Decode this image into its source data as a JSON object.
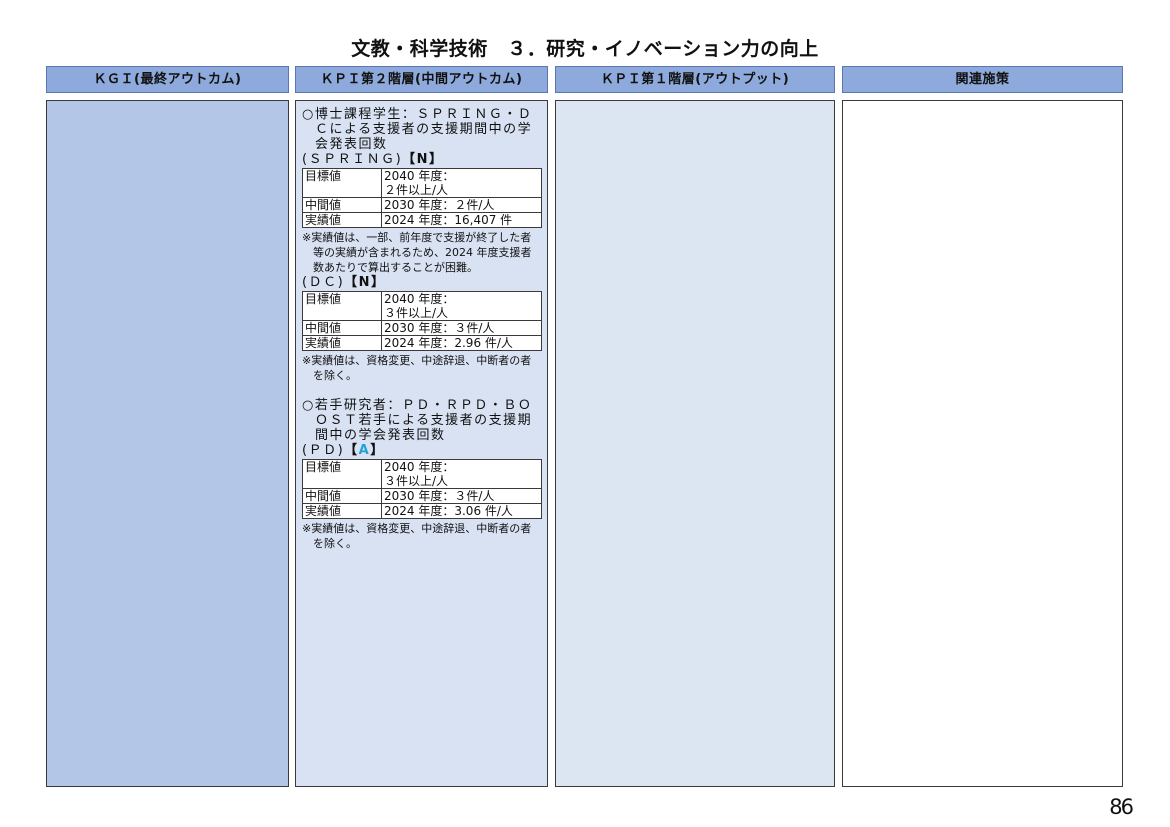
{
  "title": "文教・科学技術　３．研究・イノベーション力の向上",
  "columns": {
    "kgi": "ＫＧＩ(最終アウトカム)",
    "kpi2": "ＫＰＩ第２階層(中間アウトカム)",
    "kpi1": "ＫＰＩ第１階層(アウトプット)",
    "policy": "関連施策"
  },
  "kpi2": {
    "block1": {
      "heading": "○博士課程学生：ＳＰＲＩＮＧ・ＤＣによる支援者の支援期間中の学会発表回数",
      "spring": {
        "label": "(ＳＰＲＩＮＧ)",
        "tag": "【N】",
        "rows": [
          {
            "label": "目標値",
            "value_line1": "2040 年度：",
            "value_line2": "２件以上/人"
          },
          {
            "label": "中間値",
            "value_line1": "2030 年度：２件/人",
            "value_line2": ""
          },
          {
            "label": "実績値",
            "value_line1": "2024 年度：16,407 件",
            "value_line2": ""
          }
        ],
        "note": "※実績値は、一部、前年度で支援が終了した者等の実績が含まれるため、2024 年度支援者数あたりで算出することが困難。"
      },
      "dc": {
        "label": "(ＤＣ)",
        "tag": "【N】",
        "rows": [
          {
            "label": "目標値",
            "value_line1": "2040 年度：",
            "value_line2": "３件以上/人"
          },
          {
            "label": "中間値",
            "value_line1": "2030 年度：３件/人",
            "value_line2": ""
          },
          {
            "label": "実績値",
            "value_line1": "2024 年度：2.96 件/人",
            "value_line2": ""
          }
        ],
        "note": "※実績値は、資格変更、中途辞退、中断者の者を除く。"
      }
    },
    "block2": {
      "heading": "○若手研究者：ＰＤ・ＲＰＤ・ＢＯＯＳＴ若手による支援者の支援期間中の学会発表回数",
      "pd": {
        "label": "(ＰＤ)",
        "tag_open": "【",
        "tag_letter": "A",
        "tag_close": "】",
        "rows": [
          {
            "label": "目標値",
            "value_line1": "2040 年度：",
            "value_line2": "３件以上/人"
          },
          {
            "label": "中間値",
            "value_line1": "2030 年度：３件/人",
            "value_line2": ""
          },
          {
            "label": "実績値",
            "value_line1": "2024 年度：3.06 件/人",
            "value_line2": ""
          }
        ],
        "note": "※実績値は、資格変更、中途辞退、中断者の者を除く。"
      }
    },
    "accent_color": "#1fa3d6"
  },
  "page_number": "86",
  "colors": {
    "header_bg": "#8ea9db",
    "kgi_bg": "#b4c6e7",
    "kpi2_bg": "#d9e2f3",
    "kpi1_bg": "#dce6f2"
  }
}
